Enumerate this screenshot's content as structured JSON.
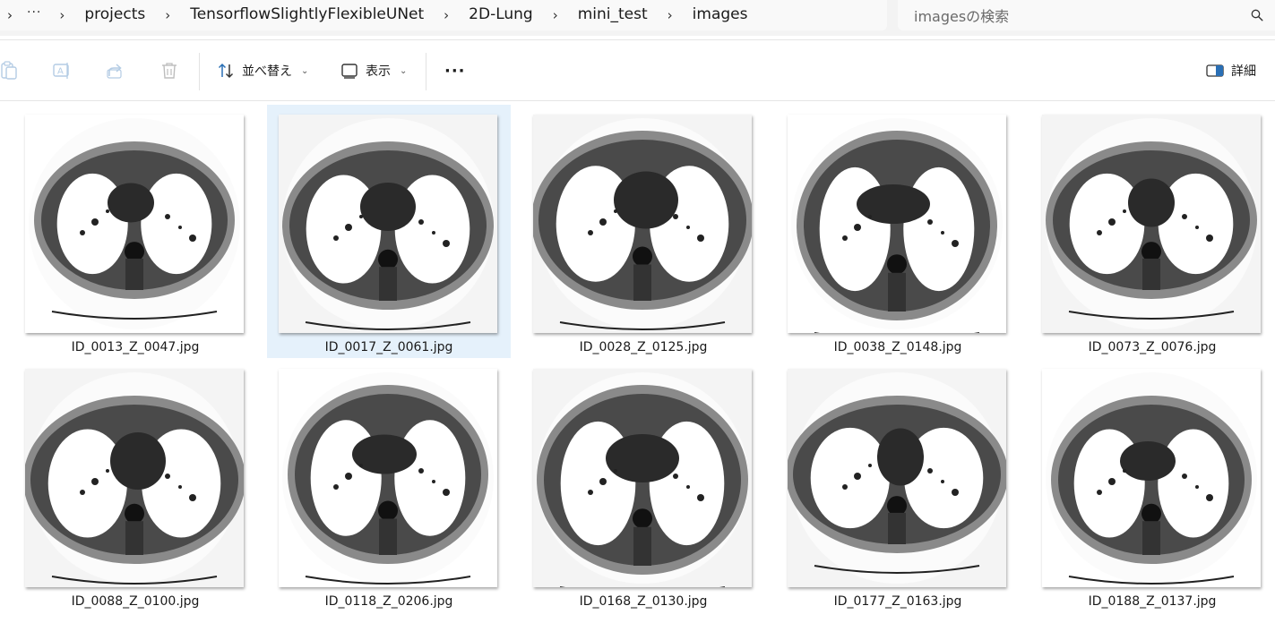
{
  "address_bar": {
    "more_label": "···",
    "breadcrumbs": [
      "projects",
      "TensorflowSlightlyFlexibleUNet",
      "2D-Lung",
      "mini_test",
      "images"
    ]
  },
  "search": {
    "placeholder": "imagesの検索"
  },
  "toolbar": {
    "sort_label": "並べ替え",
    "view_label": "表示",
    "more_label": "···",
    "details_label": "詳細"
  },
  "files": [
    {
      "name": "ID_0013_Z_0047.jpg",
      "selected": false
    },
    {
      "name": "ID_0017_Z_0061.jpg",
      "selected": true
    },
    {
      "name": "ID_0028_Z_0125.jpg",
      "selected": false
    },
    {
      "name": "ID_0038_Z_0148.jpg",
      "selected": false
    },
    {
      "name": "ID_0073_Z_0076.jpg",
      "selected": false
    },
    {
      "name": "ID_0088_Z_0100.jpg",
      "selected": false
    },
    {
      "name": "ID_0118_Z_0206.jpg",
      "selected": false
    },
    {
      "name": "ID_0168_Z_0130.jpg",
      "selected": false
    },
    {
      "name": "ID_0177_Z_0163.jpg",
      "selected": false
    },
    {
      "name": "ID_0188_Z_0137.jpg",
      "selected": false
    }
  ]
}
